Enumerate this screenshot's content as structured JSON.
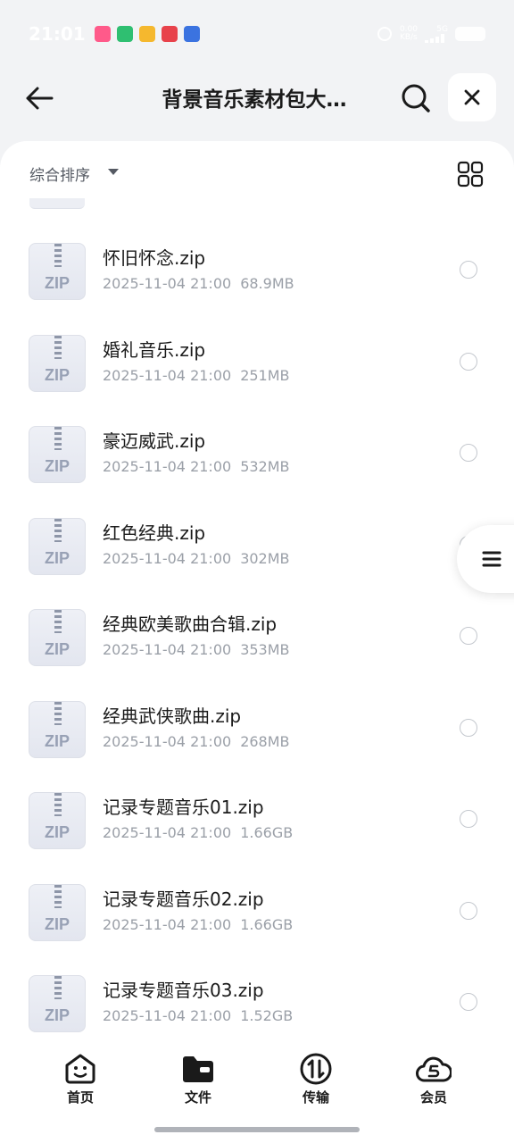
{
  "status_bar": {
    "time": "21:01",
    "app_icons": [
      {
        "name": "lala-app-icon",
        "color": "#ff5a8a"
      },
      {
        "name": "green-app-icon",
        "color": "#2fbf71"
      },
      {
        "name": "mail-app-icon",
        "color": "#f5b82e"
      },
      {
        "name": "red-app-icon",
        "color": "#e8424b"
      },
      {
        "name": "paw-app-icon",
        "color": "#3b73e0"
      }
    ],
    "network_speed": "0.00",
    "network_unit": "KB/s",
    "signal_label": "5G"
  },
  "header": {
    "title": "背景音乐素材包大…",
    "back_icon": "arrow-left-icon",
    "search_icon": "search-icon",
    "close_icon": "close-icon"
  },
  "toolbar": {
    "sort_label": "综合排序",
    "sort_icon": "caret-down-icon",
    "view_icon": "grid-view-icon"
  },
  "files": [
    {
      "name": "怀旧怀念.zip",
      "date": "2025-11-04 21:00",
      "size": "68.9MB"
    },
    {
      "name": "婚礼音乐.zip",
      "date": "2025-11-04 21:00",
      "size": "251MB"
    },
    {
      "name": "豪迈威武.zip",
      "date": "2025-11-04 21:00",
      "size": "532MB"
    },
    {
      "name": "红色经典.zip",
      "date": "2025-11-04 21:00",
      "size": "302MB"
    },
    {
      "name": "经典欧美歌曲合辑.zip",
      "date": "2025-11-04 21:00",
      "size": "353MB"
    },
    {
      "name": "经典武侠歌曲.zip",
      "date": "2025-11-04 21:00",
      "size": "268MB"
    },
    {
      "name": "记录专题音乐01.zip",
      "date": "2025-11-04 21:00",
      "size": "1.66GB"
    },
    {
      "name": "记录专题音乐02.zip",
      "date": "2025-11-04 21:00",
      "size": "1.66GB"
    },
    {
      "name": "记录专题音乐03.zip",
      "date": "2025-11-04 21:00",
      "size": "1.52GB"
    }
  ],
  "zip_badge": "ZIP",
  "float_menu_icon": "menu-lines-icon",
  "bottom_nav": [
    {
      "label": "首页",
      "icon": "home-face-icon"
    },
    {
      "label": "文件",
      "icon": "folder-icon"
    },
    {
      "label": "传输",
      "icon": "transfer-icon"
    },
    {
      "label": "会员",
      "icon": "vip-cloud-icon"
    }
  ]
}
